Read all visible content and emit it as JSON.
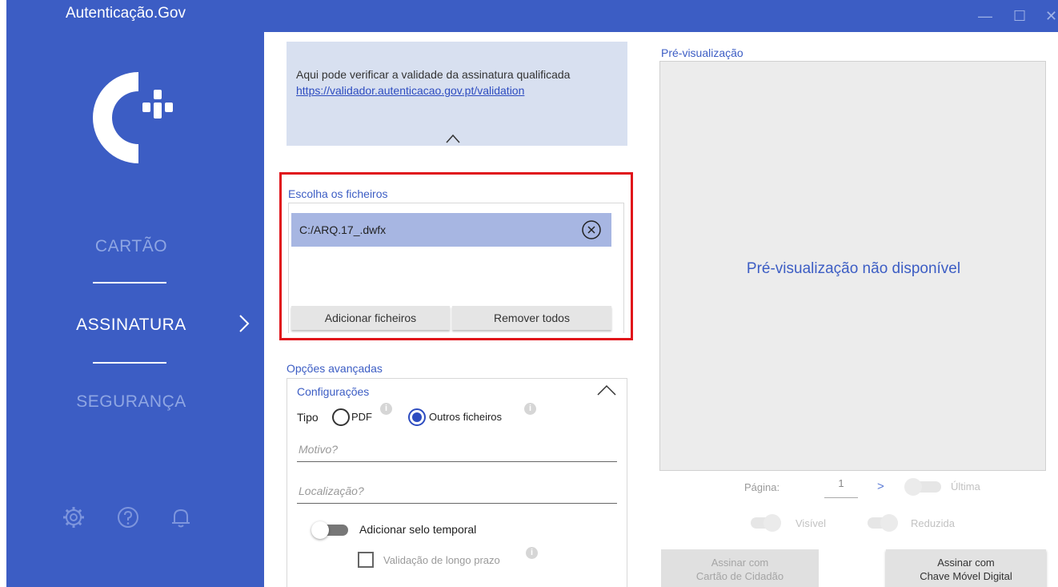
{
  "window": {
    "title": "Autenticação.Gov",
    "minimize_symbol": "—",
    "maximize_symbol": "☐",
    "close_symbol": "✕"
  },
  "sidebar": {
    "logo_icon": "autenticacao-gov-logo",
    "items": [
      {
        "label": "CARTÃO",
        "state": "inactive"
      },
      {
        "label": "ASSINATURA",
        "state": "active"
      },
      {
        "label": "SEGURANÇA",
        "state": "inactive"
      }
    ],
    "bottom_icons": [
      "gear-icon",
      "help-icon",
      "bell-icon"
    ]
  },
  "info": {
    "text": "Aqui pode verificar a validade da assinatura qualificada",
    "link": "https://validador.autenticacao.gov.pt/validation"
  },
  "files": {
    "title": "Escolha os ficheiros",
    "items": [
      {
        "name": "C:/ARQ.17_.dwfx"
      }
    ],
    "add_label": "Adicionar ficheiros",
    "remove_all_label": "Remover todos"
  },
  "advanced": {
    "title": "Opções avançadas",
    "config_title": "Configurações",
    "type_label": "Tipo",
    "type_options": [
      {
        "label": "PDF",
        "selected": false
      },
      {
        "label": "Outros ficheiros",
        "selected": true
      }
    ],
    "reason_placeholder": "Motivo?",
    "location_placeholder": "Localização?",
    "timestamp_label": "Adicionar selo temporal",
    "timestamp_enabled": false,
    "long_term_label": "Validação de longo prazo",
    "long_term_checked": false
  },
  "preview": {
    "title": "Pré-visualização",
    "message": "Pré-visualização não disponível",
    "page_label": "Página:",
    "page_value": "1",
    "next_symbol": ">",
    "last_label": "Última",
    "visible_label": "Visível",
    "reduced_label": "Reduzida"
  },
  "sign": {
    "cc_line1": "Assinar com",
    "cc_line2": "Cartão de Cidadão",
    "cmd_line1": "Assinar com",
    "cmd_line2": "Chave Móvel Digital"
  },
  "colors": {
    "brand_blue": "#3c5dc4",
    "highlight_red": "#e0131a",
    "selected_row": "#a7b6e2"
  }
}
